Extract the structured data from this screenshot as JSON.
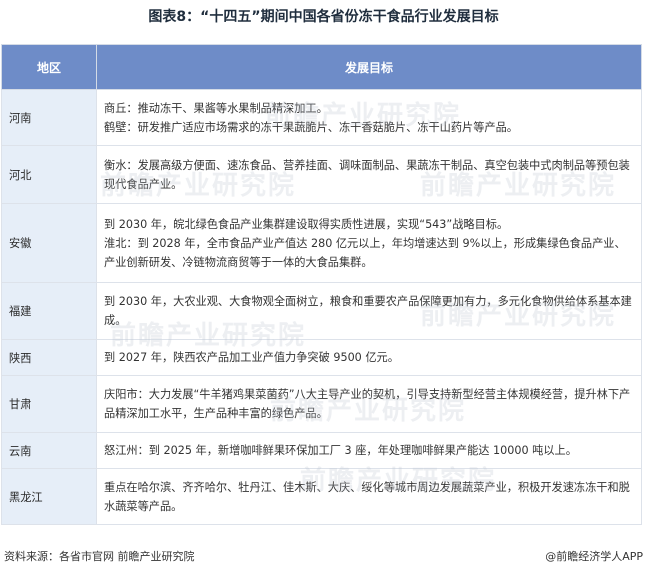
{
  "title": "图表8：“十四五”期间中国各省份冻干食品行业发展目标",
  "table": {
    "headers": {
      "region": "地区",
      "goal": "发展目标"
    },
    "rows": [
      {
        "region": "河南",
        "goals": [
          "商丘：推动冻干、果酱等水果制品精深加工。",
          "鹤壁：研发推广适应市场需求的冻干果蔬脆片、冻干香菇脆片、冻干山药片等产品。"
        ]
      },
      {
        "region": "河北",
        "goals": [
          "衡水：发展高级方便面、速冻食品、营养挂面、调味面制品、果蔬冻干制品、真空包装中式肉制品等预包装现代食品产业。"
        ]
      },
      {
        "region": "安徽",
        "goals": [
          "到 2030 年，皖北绿色食品产业集群建设取得实质性进展，实现“543”战略目标。",
          "淮北：到 2028 年，全市食品产业产值达 280 亿元以上，年均增速达到 9%以上，形成集绿色食品产业、产业创新研发、冷链物流商贸等于一体的大食品集群。"
        ]
      },
      {
        "region": "福建",
        "goals": [
          "到 2030 年，大农业观、大食物观全面树立，粮食和重要农产品保障更加有力，多元化食物供给体系基本建成。"
        ]
      },
      {
        "region": "陕西",
        "goals": [
          "到 2027 年，陕西农产品加工业产值力争突破 9500 亿元。"
        ]
      },
      {
        "region": "甘肃",
        "goals": [
          "庆阳市：大力发展“牛羊猪鸡果菜菌药”八大主导产业的契机，引导支持新型经营主体规模经营，提升林下产品精深加工水平，生产品种丰富的绿色产品。"
        ]
      },
      {
        "region": "云南",
        "goals": [
          "怒江州：到 2025 年，新增咖啡鲜果环保加工厂 3 座，年处理咖啡鲜果产能达 10000 吨以上。"
        ]
      },
      {
        "region": "黑龙江",
        "goals": [
          "重点在哈尔滨、齐齐哈尔、牡丹江、佳木斯、大庆、绥化等城市周边发展蔬菜产业，积极开发速冻冻干和脱水蔬菜等产品。"
        ]
      }
    ]
  },
  "footer": {
    "source": "资料来源：各省市官网 前瞻产业研究院",
    "brand": "@前瞻经济学人APP"
  },
  "watermark": {
    "text": "前瞻产业研究院"
  }
}
